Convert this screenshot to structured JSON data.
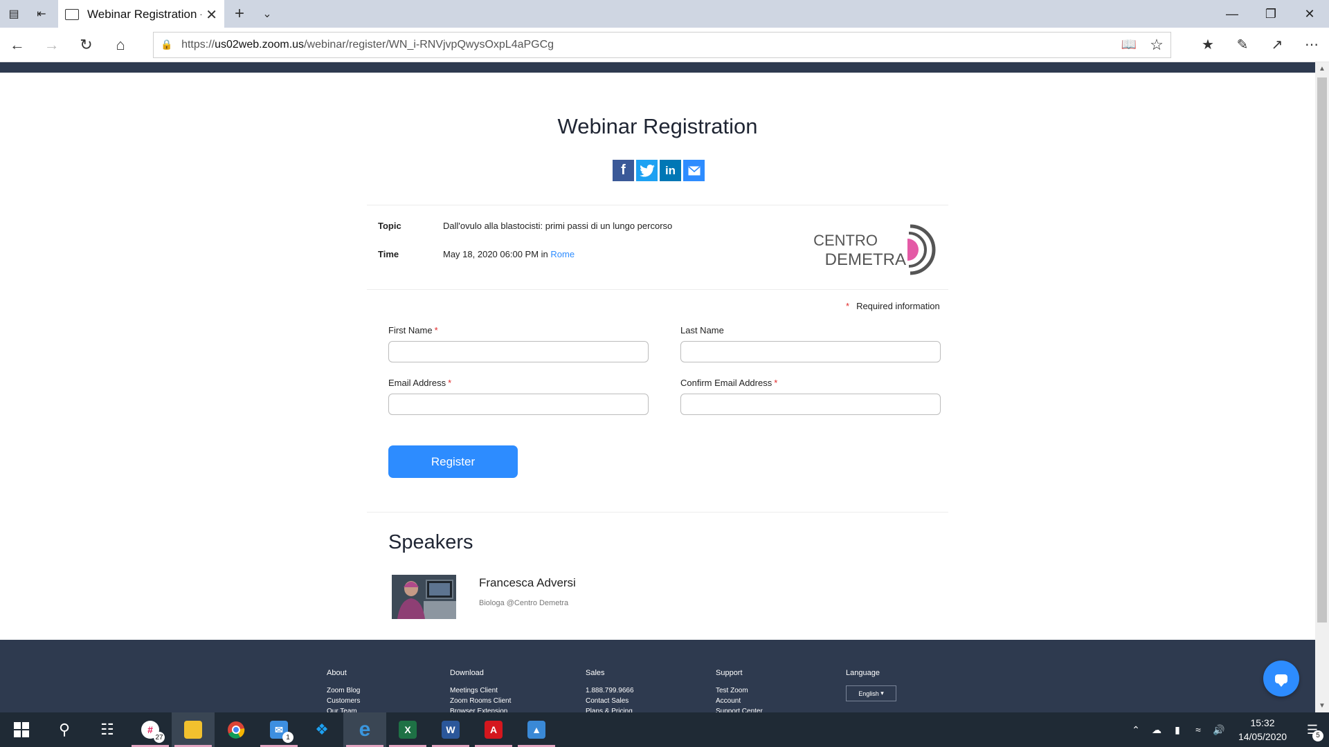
{
  "browser": {
    "tab_title": "Webinar Registration - Zoom",
    "url_prefix": "https://",
    "url_domain": "us02web.zoom.us",
    "url_path": "/webinar/register/WN_i-RNVjvpQwysOxpL4aPGCg"
  },
  "page": {
    "title": "Webinar Registration",
    "topic_label": "Topic",
    "topic_value": "Dall'ovulo alla blastocisti: primi passi di un lungo percorso",
    "time_label": "Time",
    "time_value": "May 18, 2020 06:00 PM",
    "time_in": "in",
    "time_zone": "Rome",
    "logo_line1": "CENTRO",
    "logo_line2": "DEMETRA"
  },
  "form": {
    "required_note": "Required information",
    "required_mark": "*",
    "first_name_label": "First Name",
    "last_name_label": "Last Name",
    "email_label": "Email Address",
    "confirm_email_label": "Confirm Email Address",
    "register_label": "Register"
  },
  "speakers": {
    "heading": "Speakers",
    "items": [
      {
        "name": "Francesca Adversi",
        "title": "Biologa @Centro Demetra"
      }
    ]
  },
  "footer": {
    "about": {
      "heading": "About",
      "links": [
        "Zoom Blog",
        "Customers",
        "Our Team"
      ]
    },
    "download": {
      "heading": "Download",
      "links": [
        "Meetings Client",
        "Zoom Rooms Client",
        "Browser Extension"
      ]
    },
    "sales": {
      "heading": "Sales",
      "links": [
        "1.888.799.9666",
        "Contact Sales",
        "Plans & Pricing"
      ]
    },
    "support": {
      "heading": "Support",
      "links": [
        "Test Zoom",
        "Account",
        "Support Center"
      ]
    },
    "language": {
      "heading": "Language",
      "selected": "English"
    }
  },
  "taskbar": {
    "slack_badge": "27",
    "mail_badge": "1",
    "time": "15:32",
    "date": "14/05/2020",
    "notifications": "5"
  },
  "colors": {
    "accent": "#2d8cff",
    "footer_bg": "#2e3a4f",
    "required": "#e02828",
    "logo_pink": "#e45aa6"
  }
}
